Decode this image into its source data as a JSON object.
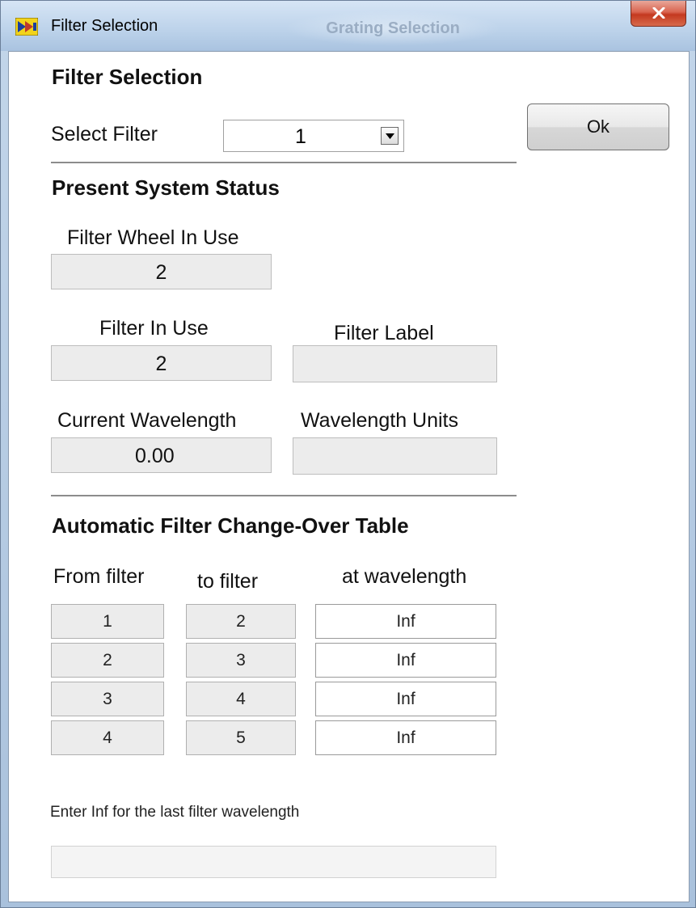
{
  "window": {
    "title": "Filter Selection",
    "background_title": "Grating Selection"
  },
  "filter_selection": {
    "heading": "Filter Selection",
    "select_label": "Select Filter",
    "select_value": "1",
    "ok_label": "Ok"
  },
  "status": {
    "heading": "Present System Status",
    "wheel_label": "Filter Wheel In Use",
    "wheel_value": "2",
    "filter_label": "Filter In Use",
    "filter_value": "2",
    "filter_name_label": "Filter Label",
    "filter_name_value": "",
    "wavelength_label": "Current Wavelength",
    "wavelength_value": "0.00",
    "units_label": "Wavelength Units",
    "units_value": ""
  },
  "table": {
    "heading": "Automatic Filter Change-Over Table",
    "col_from": "From filter",
    "col_to": "to filter",
    "col_at": "at wavelength",
    "rows": [
      {
        "from": "1",
        "to": "2",
        "at": "Inf"
      },
      {
        "from": "2",
        "to": "3",
        "at": "Inf"
      },
      {
        "from": "3",
        "to": "4",
        "at": "Inf"
      },
      {
        "from": "4",
        "to": "5",
        "at": "Inf"
      }
    ]
  },
  "footer": {
    "hint": "Enter Inf for the last filter wavelength",
    "status_value": ""
  },
  "colors": {
    "close_button": "#c4391f",
    "field_background": "#ececec"
  }
}
